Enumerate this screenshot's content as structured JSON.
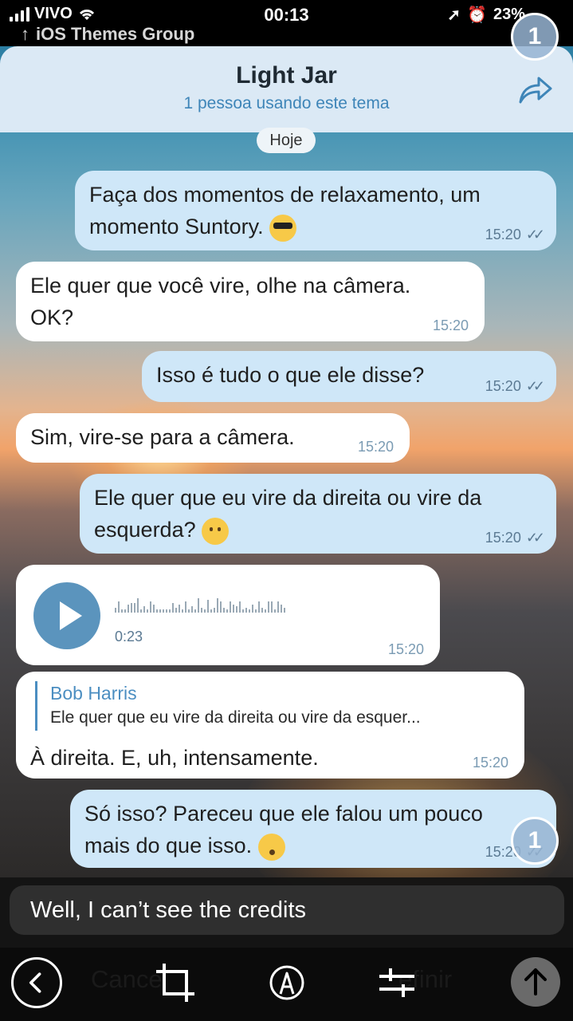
{
  "status_bar": {
    "carrier": "VIVO",
    "group": "iOS Themes Group",
    "time": "00:13",
    "battery": "23%"
  },
  "badges": {
    "top_count": "1",
    "bottom_count": "1"
  },
  "header": {
    "title": "Light Jar",
    "subtitle": "1 pessoa usando este tema",
    "share_icon": "share-arrow-icon"
  },
  "date_label": "Hoje",
  "messages": [
    {
      "dir": "out",
      "text_1": "Faça dos momentos de relaxamento, um",
      "text_2": "momento Suntory.",
      "emoji": "smiling-face-with-sunglasses",
      "time": "15:20"
    },
    {
      "dir": "in",
      "text_1": "Ele quer que você vire, olhe na câmera.",
      "text_2": "OK?",
      "time": "15:20"
    },
    {
      "dir": "out",
      "text_1": "Isso é tudo o que ele disse?",
      "time": "15:20"
    },
    {
      "dir": "in",
      "text_1": "Sim, vire-se para a câmera.",
      "time": "15:20"
    },
    {
      "dir": "out",
      "text_1": "Ele quer que eu vire da direita ou vire da",
      "text_2": "esquerda?",
      "emoji": "thinking-face",
      "time": "15:20"
    },
    {
      "dir": "in",
      "type": "voice",
      "duration": "0:23",
      "time": "15:20"
    },
    {
      "dir": "in",
      "reply_to_name": "Bob Harris",
      "reply_to_text": "Ele quer que eu vire da direita ou vire da esquer...",
      "text_1": "À direita. E, uh, intensamente.",
      "time": "15:20"
    },
    {
      "dir": "out",
      "text_1": "Só isso? Pareceu que ele falou um pouco",
      "text_2": "mais do que isso.",
      "emoji": "hushed-face",
      "time": "15:20"
    }
  ],
  "caption": "Well, I can’t see the credits",
  "toolbar": {
    "back_icon": "back-chevron-icon",
    "ghost_left": "Cancel",
    "crop_icon": "crop-icon",
    "markup_icon": "markup-pen-icon",
    "adjust_icon": "adjust-sliders-icon",
    "ghost_right": "efinir",
    "send_icon": "send-arrow-icon"
  }
}
